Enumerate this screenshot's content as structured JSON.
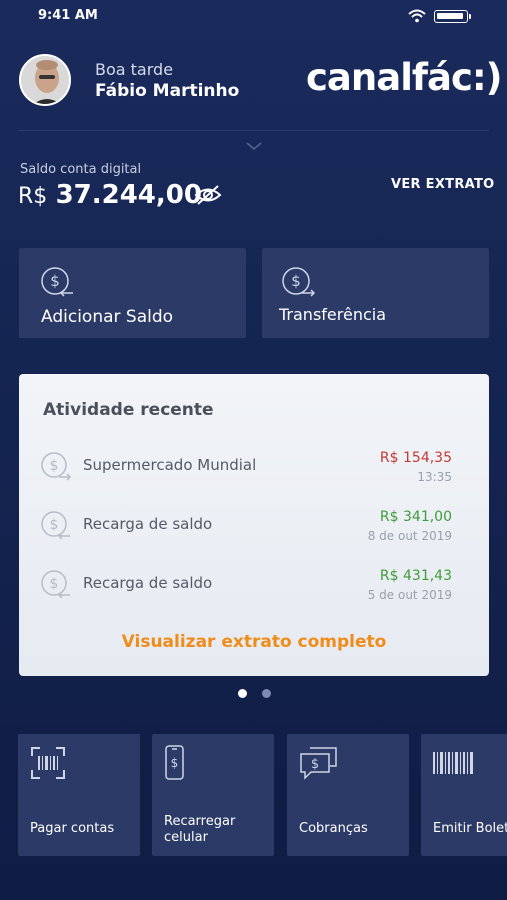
{
  "status": {
    "time": "9:41 AM"
  },
  "user": {
    "greeting": "Boa tarde",
    "name": "Fábio Martinho"
  },
  "brand": {
    "logo": "canalfác:)"
  },
  "balance": {
    "label": "Saldo conta digital",
    "currency": "R$",
    "amount": "37.244,00",
    "link": "VER EXTRATO"
  },
  "actions": [
    {
      "label": "Adicionar Saldo",
      "icon": "dollar-in-icon"
    },
    {
      "label": "Transferência",
      "icon": "dollar-out-icon"
    }
  ],
  "activity": {
    "title": "Atividade recente",
    "items": [
      {
        "desc": "Supermercado Mundial",
        "amount": "R$ 154,35",
        "date": "13:35",
        "type": "out"
      },
      {
        "desc": "Recarga de saldo",
        "amount": "R$ 341,00",
        "date": "8 de out 2019",
        "type": "in"
      },
      {
        "desc": "Recarga de saldo",
        "amount": "R$ 431,43",
        "date": "5 de out 2019",
        "type": "in"
      }
    ],
    "link": "Visualizar extrato completo"
  },
  "pager": {
    "pages": 2,
    "active": 1
  },
  "quick": [
    {
      "label": "Pagar contas",
      "icon": "barcode-scan-icon"
    },
    {
      "label": "Recarregar celular",
      "line1": "Recarregar",
      "line2": "celular",
      "icon": "phone-dollar-icon"
    },
    {
      "label": "Cobranças",
      "icon": "chat-dollar-icon"
    },
    {
      "label": "Emitir Boleto",
      "icon": "barcode-icon"
    }
  ],
  "colors": {
    "background": "#1a2a5c",
    "card": "#2c3a68",
    "accent": "#f08c19",
    "negative": "#c23a35",
    "positive": "#3f9c3a"
  }
}
